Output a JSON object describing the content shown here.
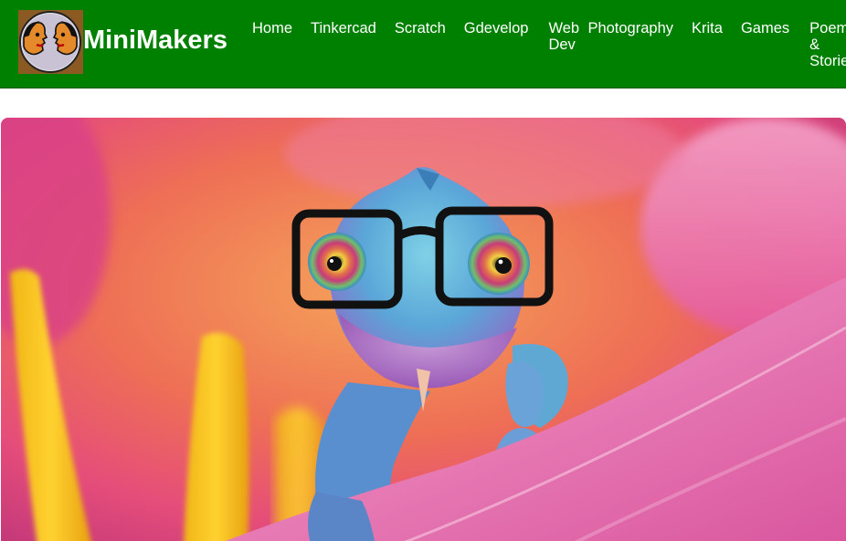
{
  "site": {
    "brand": "MiniMakers"
  },
  "nav": {
    "items": [
      {
        "label": "Home"
      },
      {
        "label": "Tinkercad"
      },
      {
        "label": "Scratch"
      },
      {
        "label": "Gdevelop"
      },
      {
        "label": "Web Dev"
      },
      {
        "label": "Photography"
      },
      {
        "label": "Krita"
      },
      {
        "label": "Games"
      },
      {
        "label": "Poems & Stories"
      }
    ]
  },
  "colors": {
    "header_bg": "#008000",
    "nav_text": "#ffffff"
  },
  "icons": {
    "logo": "two-faces-logo-icon"
  }
}
